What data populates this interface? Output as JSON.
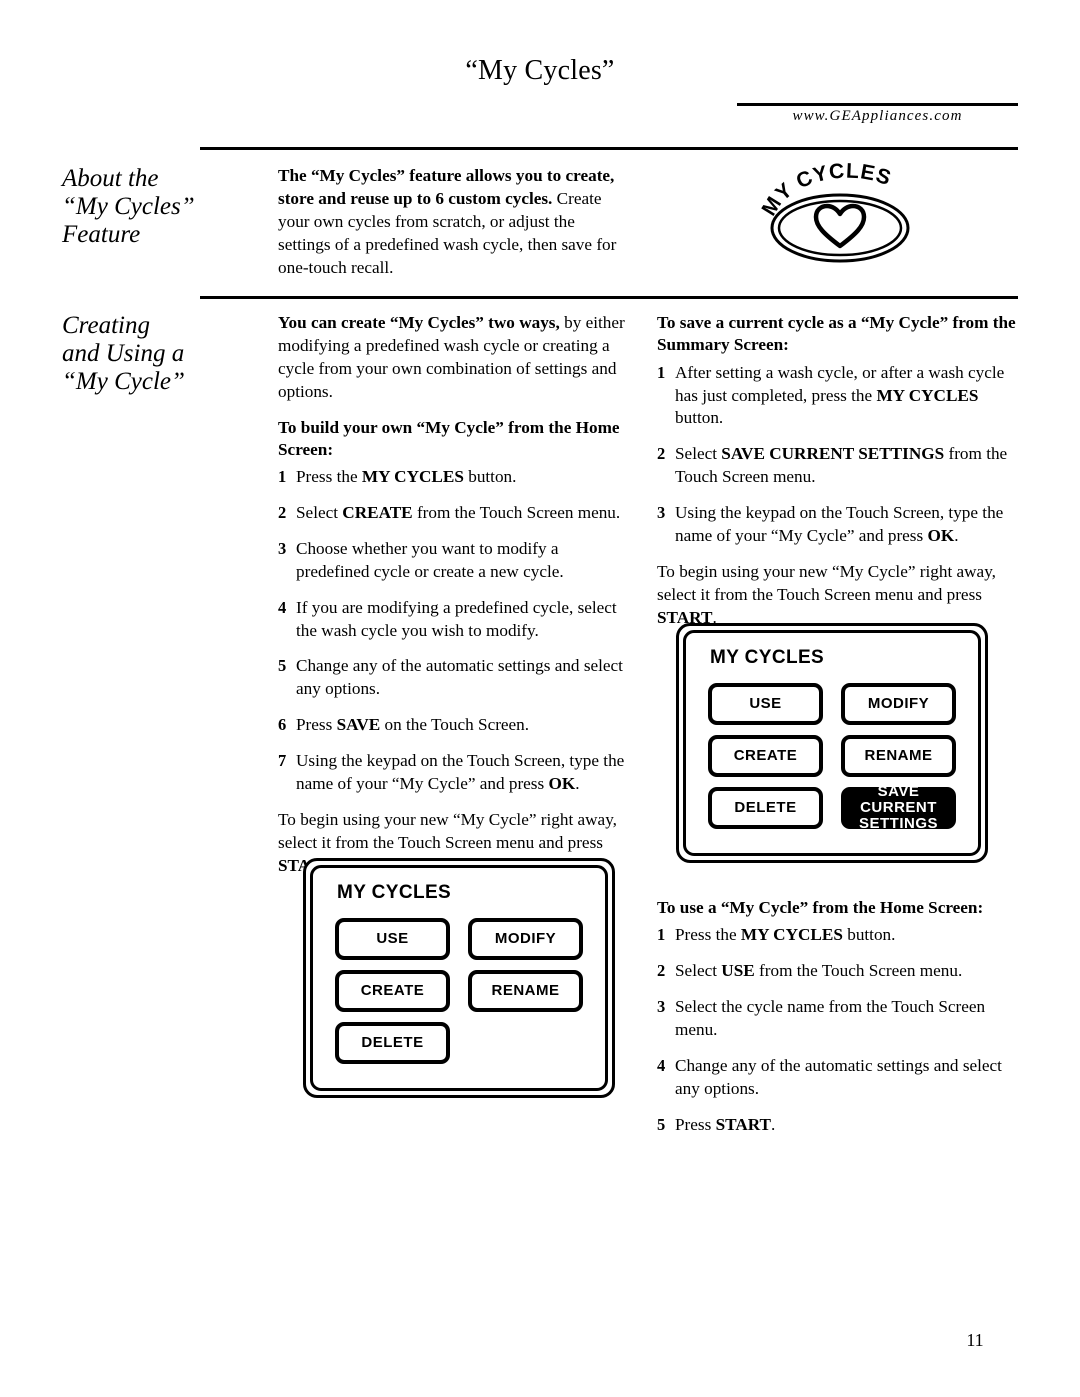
{
  "header": {
    "title": "“My Cycles”",
    "url": "www.GEAppliances.com"
  },
  "sidebar": {
    "heading_1": "About the\n“My Cycles”\nFeature",
    "heading_2": "Creating\nand Using a\n“My Cycle”"
  },
  "logo": {
    "text": "MY CYCLES",
    "icon": "heart-icon"
  },
  "about": {
    "paragraph_bold": "The “My Cycles” feature allows you to create, store and reuse up to 6 custom cycles.",
    "paragraph_rest": " Create your own cycles from scratch, or adjust the settings of a predefined wash cycle, then save for one-touch recall."
  },
  "creating": {
    "intro_bold": "You can create “My Cycles” two ways,",
    "intro_rest": " by either modifying a predefined wash cycle or creating a cycle from your own combination of settings and options.",
    "build_subhead": "To build your own “My Cycle” from the Home Screen:",
    "build_steps": [
      {
        "num": "1",
        "pre": "Press the ",
        "bold": "MY CYCLES",
        "post": " button."
      },
      {
        "num": "2",
        "pre": "Select ",
        "bold": "CREATE",
        "post": " from the Touch Screen menu."
      },
      {
        "num": "3",
        "pre": "Choose whether you want to modify a predefined cycle or create a new cycle.",
        "bold": "",
        "post": ""
      },
      {
        "num": "4",
        "pre": "If you are modifying a predefined cycle, select the wash cycle you wish to modify.",
        "bold": "",
        "post": ""
      },
      {
        "num": "5",
        "pre": "Change any of the automatic settings and select any options.",
        "bold": "",
        "post": ""
      },
      {
        "num": "6",
        "pre": "Press ",
        "bold": "SAVE",
        "post": " on the Touch Screen."
      },
      {
        "num": "7",
        "pre": "Using the keypad on the Touch Screen, type the name of your “My Cycle” and press ",
        "bold": "OK",
        "post": "."
      }
    ],
    "begin_pre": "To begin using your new “My Cycle” right away, select it from the Touch Screen menu and press ",
    "begin_bold": "START",
    "begin_post": "."
  },
  "saving": {
    "subhead": "To save a current cycle as a “My Cycle” from the Summary Screen:",
    "steps": [
      {
        "num": "1",
        "pre": "After setting a wash cycle, or after a wash cycle has just completed, press the ",
        "bold": "MY CYCLES",
        "post": " button."
      },
      {
        "num": "2",
        "pre": "Select ",
        "bold": "SAVE CURRENT SETTINGS",
        "post": " from the Touch Screen menu."
      },
      {
        "num": "3",
        "pre": "Using the keypad on the Touch Screen, type the name of your “My Cycle” and press ",
        "bold": "OK",
        "post": "."
      }
    ],
    "begin_pre": "To begin using your new “My Cycle” right away, select it from the Touch Screen menu and press ",
    "begin_bold": "START",
    "begin_post": "."
  },
  "using": {
    "subhead": "To use a “My Cycle” from the Home Screen:",
    "steps": [
      {
        "num": "1",
        "pre": "Press the ",
        "bold": "MY CYCLES",
        "post": " button."
      },
      {
        "num": "2",
        "pre": "Select ",
        "bold": "USE",
        "post": " from the Touch Screen menu."
      },
      {
        "num": "3",
        "pre": "Select the cycle name from the Touch Screen menu.",
        "bold": "",
        "post": ""
      },
      {
        "num": "4",
        "pre": "Change any of the automatic settings and select any options.",
        "bold": "",
        "post": ""
      },
      {
        "num": "5",
        "pre": "Press ",
        "bold": "START",
        "post": "."
      }
    ]
  },
  "panel_left": {
    "title": "MY CYCLES",
    "buttons": [
      {
        "label": "USE",
        "inverted": false
      },
      {
        "label": "MODIFY",
        "inverted": false
      },
      {
        "label": "CREATE",
        "inverted": false
      },
      {
        "label": "RENAME",
        "inverted": false
      },
      {
        "label": "DELETE",
        "inverted": false
      },
      {
        "label": "",
        "inverted": false,
        "empty": true
      }
    ]
  },
  "panel_right": {
    "title": "MY CYCLES",
    "buttons": [
      {
        "label": "USE",
        "inverted": false
      },
      {
        "label": "MODIFY",
        "inverted": false
      },
      {
        "label": "CREATE",
        "inverted": false
      },
      {
        "label": "RENAME",
        "inverted": false
      },
      {
        "label": "DELETE",
        "inverted": false
      },
      {
        "label": "SAVE CURRENT\nSETTINGS",
        "inverted": true
      }
    ]
  },
  "footer": {
    "page_number": "11"
  },
  "colors": {
    "text": "#000000",
    "background": "#ffffff",
    "button_border": "#000000",
    "button_highlight_bg": "#000000",
    "button_highlight_text": "#ffffff"
  }
}
